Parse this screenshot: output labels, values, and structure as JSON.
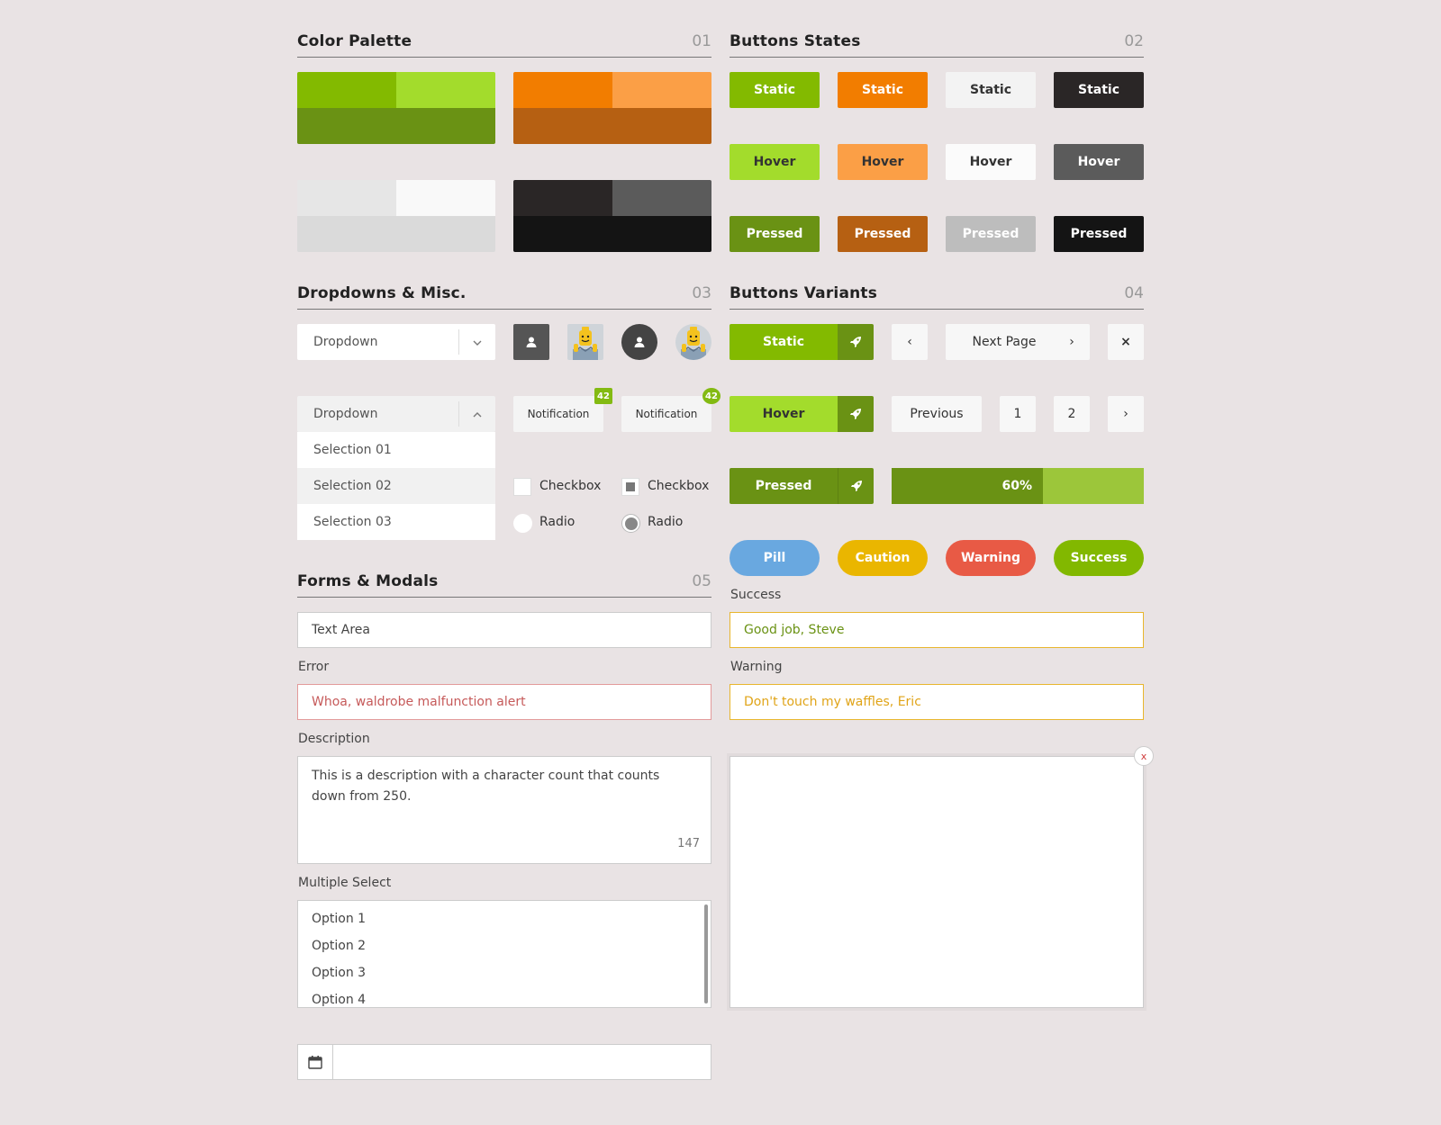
{
  "colors": {
    "green": "#83ba00",
    "green_light": "#a3dc2c",
    "green_dark": "#6a9214",
    "orange": "#f27d00",
    "orange_light": "#fb9f46",
    "orange_dark": "#b66012",
    "gray_light": "#e6e6e6",
    "white": "#f9f9f9",
    "gray_mid": "#dadada",
    "charcoal": "#2a2626",
    "charcoal_light": "#5b5b5b",
    "black": "#141414",
    "pill_blue": "#69a8e0",
    "caution": "#eab600",
    "warning": "#e85a45",
    "success": "#82b800"
  },
  "sections": {
    "palette": {
      "title": "Color Palette",
      "num": "01"
    },
    "states": {
      "title": "Buttons States",
      "num": "02"
    },
    "dropdowns": {
      "title": "Dropdowns & Misc.",
      "num": "03"
    },
    "variants": {
      "title": "Buttons Variants",
      "num": "04"
    },
    "forms": {
      "title": "Forms & Modals",
      "num": "05"
    }
  },
  "states": {
    "static": "Static",
    "hover": "Hover",
    "pressed": "Pressed"
  },
  "dropdowns": {
    "closed_label": "Dropdown",
    "open_label": "Dropdown",
    "selections": [
      "Selection 01",
      "Selection 02",
      "Selection 03"
    ],
    "notification": "Notification",
    "badge_count": "42",
    "checkbox": "Checkbox",
    "radio": "Radio",
    "user_icon": "user-icon",
    "lego_icon": "lego-avatar"
  },
  "variants": {
    "static": "Static",
    "hover": "Hover",
    "pressed": "Pressed",
    "rocket_icon": "rocket-icon",
    "prev_arrow": "‹",
    "next_page": "Next Page",
    "next_arrow": "›",
    "close": "×",
    "previous": "Previous",
    "page1": "1",
    "page2": "2",
    "progress_label": "60%",
    "progress": 0.6,
    "pill": "Pill",
    "caution": "Caution",
    "warning": "Warning",
    "success": "Success"
  },
  "forms": {
    "text_area_value": "Text Area",
    "error_label": "Error",
    "error_value": "Whoa, waldrobe malfunction alert",
    "description_label": "Description",
    "description_value": "This is a description with a character count that counts down from 250.",
    "char_count": "147",
    "multi_label": "Multiple Select",
    "options": [
      "Option 1",
      "Option 2",
      "Option 3",
      "Option 4"
    ],
    "success_label": "Success",
    "success_value": "Good job, Steve",
    "warning_label": "Warning",
    "warning_value": "Don't touch my waffles, Eric",
    "modal_close": "x",
    "calendar_icon": "calendar-icon",
    "date_value": ""
  }
}
